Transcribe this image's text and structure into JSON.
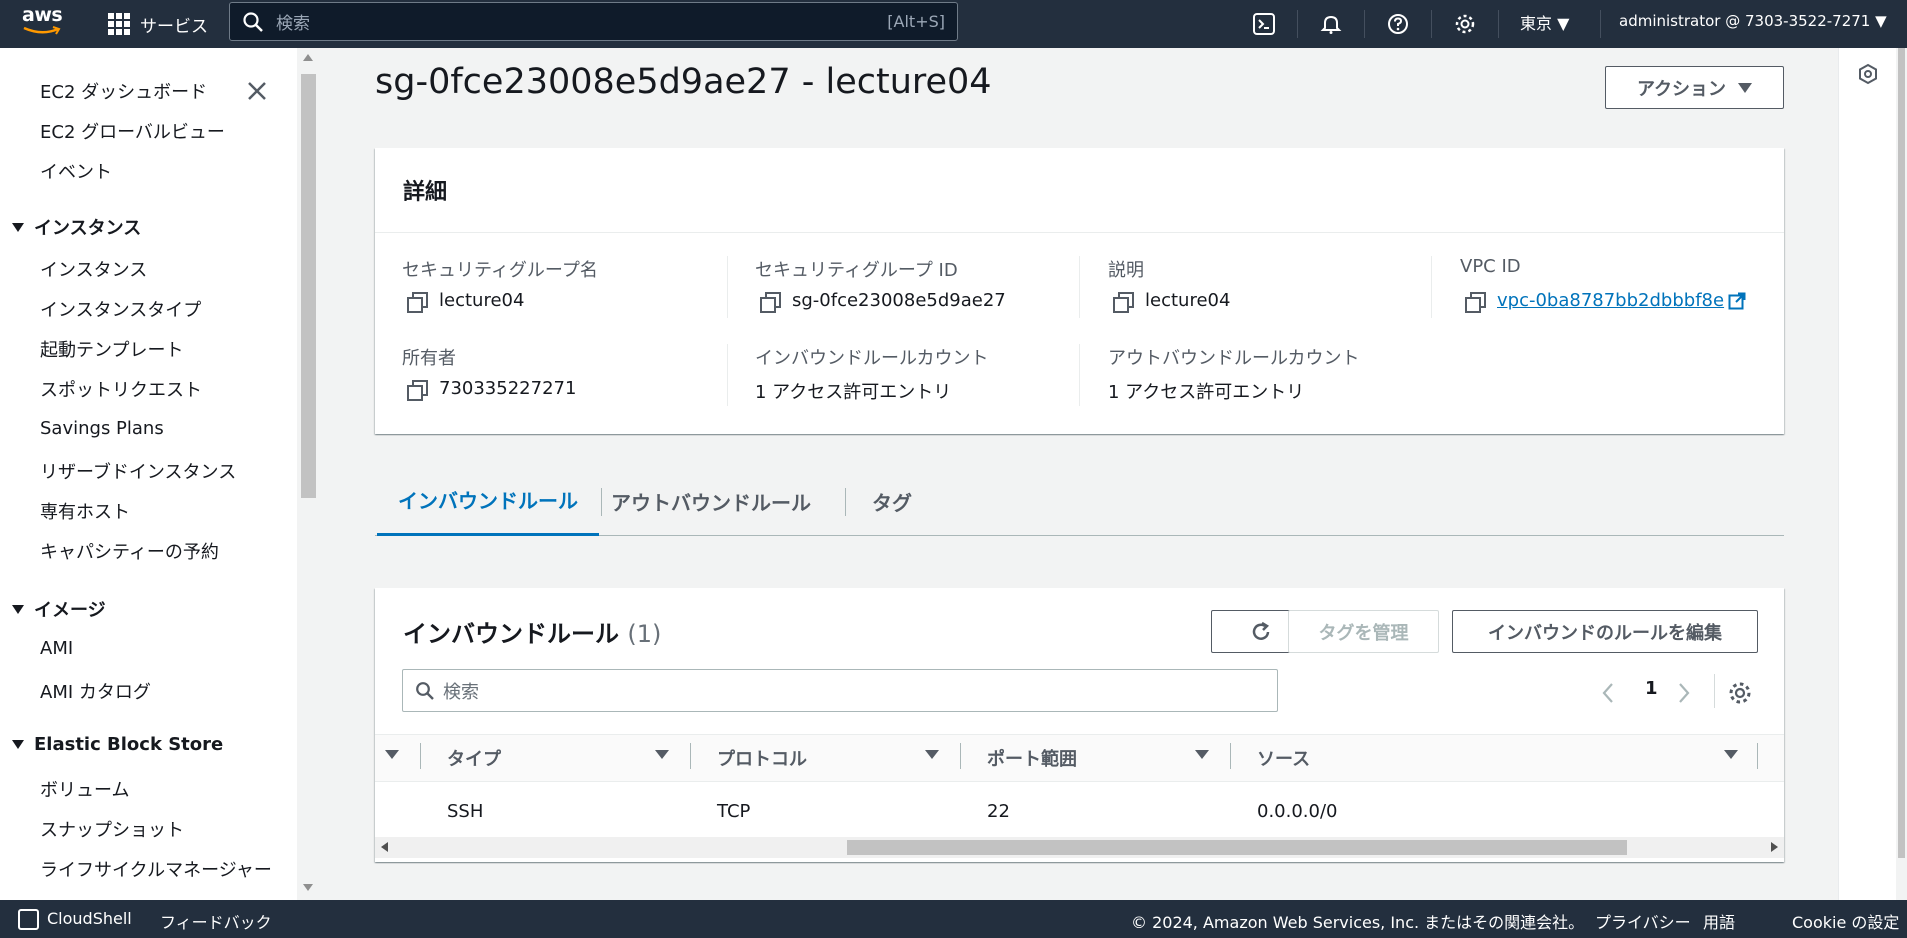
{
  "topnav": {
    "logo_text": "aws",
    "services_label": "サービス",
    "search_placeholder": "検索",
    "search_shortcut": "[Alt+S]",
    "region": "東京",
    "account": "administrator @ 7303-3522-7271"
  },
  "sidenav": {
    "items_top": [
      "EC2 ダッシュボード",
      "EC2 グローバルビュー",
      "イベント"
    ],
    "sections": [
      {
        "title": "インスタンス",
        "items": [
          "インスタンス",
          "インスタンスタイプ",
          "起動テンプレート",
          "スポットリクエスト",
          "Savings Plans",
          "リザーブドインスタンス",
          "専有ホスト",
          "キャパシティーの予約"
        ]
      },
      {
        "title": "イメージ",
        "items": [
          "AMI",
          "AMI カタログ"
        ]
      },
      {
        "title": "Elastic Block Store",
        "items": [
          "ボリューム",
          "スナップショット",
          "ライフサイクルマネージャー"
        ]
      }
    ]
  },
  "page": {
    "title": "sg-0fce23008e5d9ae27 - lecture04",
    "actions_label": "アクション"
  },
  "details": {
    "heading": "詳細",
    "fields": [
      {
        "label": "セキュリティグループ名",
        "value": "lecture04"
      },
      {
        "label": "セキュリティグループ ID",
        "value": "sg-0fce23008e5d9ae27"
      },
      {
        "label": "説明",
        "value": "lecture04"
      },
      {
        "label": "VPC ID",
        "value": "vpc-0ba8787bb2dbbbf8e"
      },
      {
        "label": "所有者",
        "value": "730335227271"
      },
      {
        "label": "インバウンドルールカウント",
        "value": "1 アクセス許可エントリ"
      },
      {
        "label": "アウトバウンドルールカウント",
        "value": "1 アクセス許可エントリ"
      }
    ]
  },
  "tabs": [
    "インバウンドルール",
    "アウトバウンドルール",
    "タグ"
  ],
  "inbound": {
    "title": "インバウンドルール",
    "count": "(1)",
    "manage_tags_label": "タグを管理",
    "edit_label": "インバウンドのルールを編集",
    "search_placeholder": "検索",
    "page": "1",
    "columns": [
      "タイプ",
      "プロトコル",
      "ポート範囲",
      "ソース"
    ],
    "rows": [
      {
        "type": "SSH",
        "protocol": "TCP",
        "port": "22",
        "source": "0.0.0.0/0"
      }
    ]
  },
  "footer": {
    "cloudshell": "CloudShell",
    "feedback": "フィードバック",
    "copyright": "© 2024, Amazon Web Services, Inc. またはその関連会社。",
    "privacy": "プライバシー",
    "terms": "用語",
    "cookie": "Cookie の設定"
  }
}
